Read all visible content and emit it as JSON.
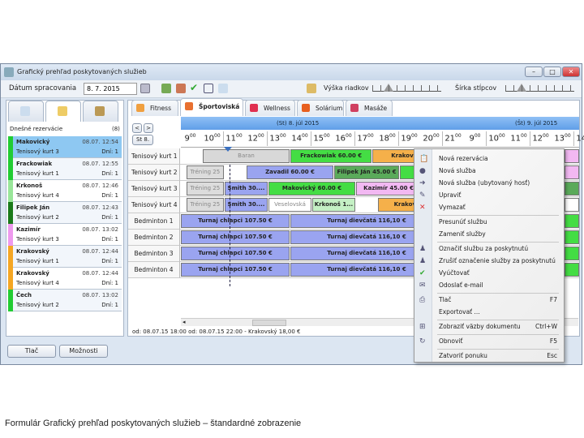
{
  "window": {
    "title": "Grafický prehľad poskytovaných služieb",
    "min": "–",
    "max": "□",
    "close": "✕"
  },
  "toolbar": {
    "date_label": "Dátum spracovania",
    "date_value": "8. 7. 2015",
    "height_label": "Výška riadkov",
    "width_label": "Šírka stĺpcov",
    "height_level": 0.3,
    "width_level": 0.25
  },
  "left": {
    "header": "Dnešné rezervácie",
    "count": "(8)",
    "items": [
      {
        "name": "Makovický",
        "date": "08.07. 12:54",
        "court": "Tenisový kurt 3",
        "days": "Dní: 1",
        "color": "#22cc33",
        "selected": true
      },
      {
        "name": "Frackowiak",
        "date": "08.07. 12:55",
        "court": "Tenisový kurt 1",
        "days": "Dní: 1",
        "color": "#22cc33"
      },
      {
        "name": "Krkonoš",
        "date": "08.07. 12:46",
        "court": "Tenisový kurt 4",
        "days": "Dní: 1",
        "color": "#99e699"
      },
      {
        "name": "Filipek Ján",
        "date": "08.07. 12:43",
        "court": "Tenisový kurt 2",
        "days": "Dní: 1",
        "color": "#1a7a1a"
      },
      {
        "name": "Kazimír",
        "date": "08.07. 13:02",
        "court": "Tenisový kurt 3",
        "days": "Dní: 1",
        "color": "#ee99ee"
      },
      {
        "name": "Krakovský",
        "date": "08.07. 12:44",
        "court": "Tenisový kurt 1",
        "days": "Dní: 1",
        "color": "#f5a623"
      },
      {
        "name": "Krakovský",
        "date": "08.07. 12:44",
        "court": "Tenisový kurt 4",
        "days": "Dní: 1",
        "color": "#f5a623"
      },
      {
        "name": "Čech",
        "date": "08.07. 13:02",
        "court": "Tenisový kurt 2",
        "days": "Dní: 1",
        "color": "#22cc33"
      }
    ],
    "print": "Tlač",
    "options": "Možnosti"
  },
  "categories": [
    {
      "label": "Fitness",
      "color": "#f0a040"
    },
    {
      "label": "Športoviská",
      "color": "#e87030",
      "active": true
    },
    {
      "label": "Wellness",
      "color": "#e03050"
    },
    {
      "label": "Solárium",
      "color": "#e86020"
    },
    {
      "label": "Masáže",
      "color": "#d04060"
    }
  ],
  "nav": {
    "prev": "<",
    "next": ">",
    "today": "St 8."
  },
  "days": [
    "(St) 8. júl 2015",
    "(Št) 9. júl 2015"
  ],
  "hours": [
    "9",
    "10",
    "11",
    "12",
    "13",
    "14",
    "15",
    "16",
    "17",
    "18",
    "19",
    "20",
    "21",
    "9",
    "10",
    "11",
    "12",
    "13",
    "14"
  ],
  "rows": [
    "Tenisový kurt 1",
    "Tenisový kurt 2",
    "Tenisový kurt 3",
    "Tenisový kurt 4",
    "Bedminton 1",
    "Bedminton 2",
    "Bedminton 3",
    "Bedminton 4"
  ],
  "bookings": [
    {
      "row": 0,
      "from": "10:00",
      "to": "14:00",
      "label": "Baran",
      "color": "#d8d8d8",
      "text": "#888"
    },
    {
      "row": 0,
      "from": "14:00",
      "to": "17:45",
      "label": "Frackowiak  60.00 €",
      "color": "#44dd44"
    },
    {
      "row": 0,
      "from": "17:45",
      "to": "21:00",
      "label": "Krakovský",
      "color": "#f5b04a"
    },
    {
      "row": 1,
      "from": "09:15",
      "to": "11:00",
      "label": "Tréning 25",
      "color": "#dcdcdc",
      "text": "#888"
    },
    {
      "row": 1,
      "from": "12:00",
      "to": "16:00",
      "label": "Zavadil  60.00 €",
      "color": "#9aa4f0"
    },
    {
      "row": 1,
      "from": "16:00",
      "to": "19:00",
      "label": "Filipek Ján  45.00 €",
      "color": "#5aaa5a"
    },
    {
      "row": 1,
      "from": "19:00",
      "to": "21:00",
      "label": "Čech",
      "color": "#44dd44"
    },
    {
      "row": 2,
      "from": "09:15",
      "to": "11:00",
      "label": "Tréning 25",
      "color": "#dcdcdc",
      "text": "#888"
    },
    {
      "row": 2,
      "from": "11:00",
      "to": "13:00",
      "label": "Smith  30....",
      "color": "#9aa4f0"
    },
    {
      "row": 2,
      "from": "13:00",
      "to": "17:00",
      "label": "Makovický  60.00 €",
      "color": "#44dd44"
    },
    {
      "row": 2,
      "from": "17:00",
      "to": "20:00",
      "label": "Kazimír  45.00 €",
      "color": "#f2b8f2"
    },
    {
      "row": 3,
      "from": "09:15",
      "to": "11:00",
      "label": "Tréning 25",
      "color": "#dcdcdc",
      "text": "#888"
    },
    {
      "row": 3,
      "from": "11:00",
      "to": "13:00",
      "label": "Smith  30....",
      "color": "#9aa4f0"
    },
    {
      "row": 3,
      "from": "13:00",
      "to": "15:00",
      "label": "Veselovská",
      "color": "#ffffff",
      "text": "#888"
    },
    {
      "row": 3,
      "from": "15:00",
      "to": "17:00",
      "label": "Krkonoš  1...",
      "color": "#c4f0c4"
    },
    {
      "row": 3,
      "from": "18:00",
      "to": "21:00",
      "label": "Krakovský",
      "color": "#f5b04a"
    },
    {
      "row": 4,
      "from": "09:00",
      "to": "14:00",
      "label": "Turnaj chlapci  107.50 €",
      "color": "#9aa4f0"
    },
    {
      "row": 4,
      "from": "14:00",
      "to": "21:00",
      "label": "Turnaj dievčatá  116,10 €",
      "color": "#9aa4f0"
    },
    {
      "row": 5,
      "from": "09:00",
      "to": "14:00",
      "label": "Turnaj chlapci  107.50 €",
      "color": "#9aa4f0"
    },
    {
      "row": 5,
      "from": "14:00",
      "to": "21:00",
      "label": "Turnaj dievčatá  116,10 €",
      "color": "#9aa4f0"
    },
    {
      "row": 6,
      "from": "09:00",
      "to": "14:00",
      "label": "Turnaj chlapci  107.50 €",
      "color": "#9aa4f0"
    },
    {
      "row": 6,
      "from": "14:00",
      "to": "21:00",
      "label": "Turnaj dievčatá  116,10 €",
      "color": "#9aa4f0"
    },
    {
      "row": 7,
      "from": "09:00",
      "to": "14:00",
      "label": "Turnaj chlapci  107.50 €",
      "color": "#9aa4f0"
    },
    {
      "row": 7,
      "from": "14:00",
      "to": "21:00",
      "label": "Turnaj dievčatá  116,10 €",
      "color": "#9aa4f0"
    }
  ],
  "status": "od: 08.07.15 18:00  od: 08.07.15 22:00  -  Krakovský  18,00 €",
  "menu": [
    {
      "label": "Nová rezervácia",
      "icon": "📋"
    },
    {
      "label": "Nová služba",
      "icon": "●"
    },
    {
      "label": "Nová služba (ubytovaný hosť)",
      "icon": "➜"
    },
    {
      "label": "Upraviť",
      "icon": "✎"
    },
    {
      "label": "Vymazať",
      "icon": "✕"
    },
    {
      "sep": true
    },
    {
      "label": "Presunúť službu"
    },
    {
      "label": "Zameniť služby"
    },
    {
      "sep": true
    },
    {
      "label": "Označiť službu za poskytnutú",
      "icon": "♟"
    },
    {
      "label": "Zrušiť označenie služby za poskytnutú",
      "icon": "♟"
    },
    {
      "label": "Vyúčtovať",
      "icon": "✔"
    },
    {
      "label": "Odoslať e-mail",
      "icon": "✉"
    },
    {
      "sep": true
    },
    {
      "label": "Tlač",
      "shortcut": "F7",
      "icon": "⎙"
    },
    {
      "label": "Exportovať ..."
    },
    {
      "sep": true
    },
    {
      "label": "Zobraziť väzby dokumentu",
      "shortcut": "Ctrl+W",
      "icon": "⊞"
    },
    {
      "sep": true
    },
    {
      "label": "Obnoviť",
      "shortcut": "F5",
      "icon": "↻"
    },
    {
      "sep": true
    },
    {
      "label": "Zatvoriť ponuku",
      "shortcut": "Esc"
    }
  ],
  "caption": "Formulár Grafický prehľad poskytovaných služieb – štandardné zobrazenie"
}
